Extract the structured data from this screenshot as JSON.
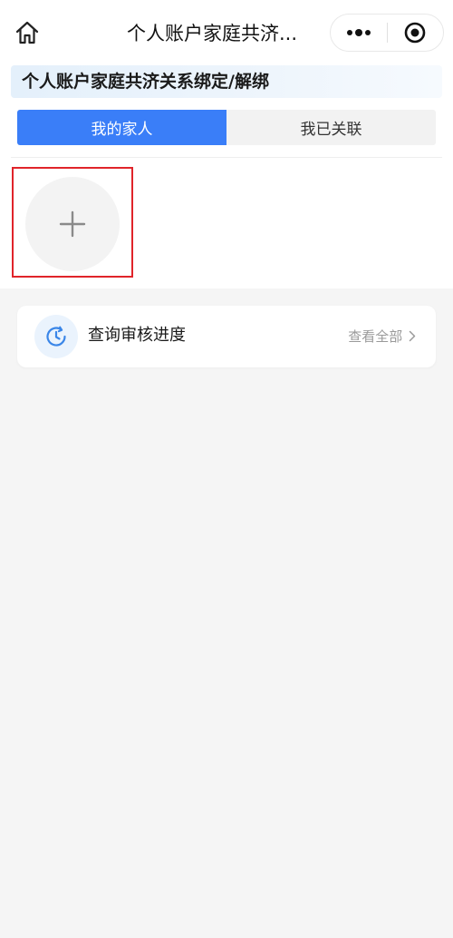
{
  "navbar": {
    "title": "个人账户家庭共济..."
  },
  "header": {
    "title": "个人账户家庭共济关系绑定/解绑"
  },
  "tabs": [
    {
      "label": "我的家人",
      "active": true
    },
    {
      "label": "我已关联",
      "active": false
    }
  ],
  "progress": {
    "label": "查询审核进度",
    "view_all": "查看全部"
  },
  "colors": {
    "accent": "#3a7ef8",
    "highlight_border": "#e0242a",
    "background": "#f5f5f5"
  }
}
